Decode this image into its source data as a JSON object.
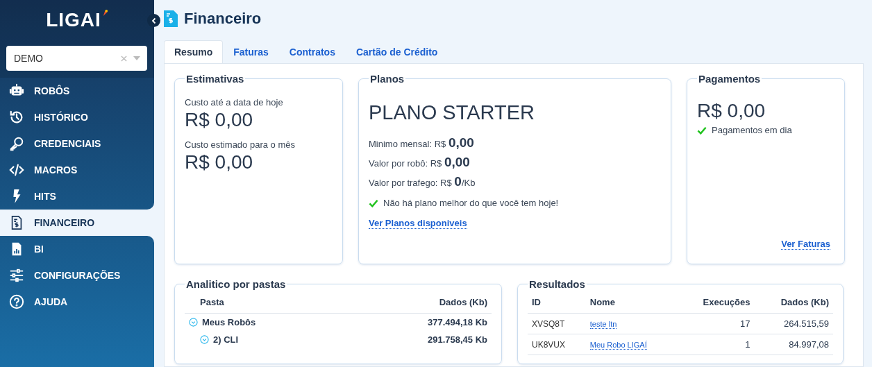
{
  "sidebar": {
    "logo": "LIGAI",
    "company_select": {
      "value": "DEMO"
    },
    "menu": [
      {
        "label": "ROBÔS",
        "kind": "robot",
        "selected": false
      },
      {
        "label": "HISTÓRICO",
        "kind": "history",
        "selected": false
      },
      {
        "label": "CREDENCIAIS",
        "kind": "key",
        "selected": false
      },
      {
        "label": "MACROS",
        "kind": "code",
        "selected": false
      },
      {
        "label": "HITS",
        "kind": "bolt",
        "selected": false
      },
      {
        "label": "FINANCEIRO",
        "kind": "invoice",
        "selected": true
      },
      {
        "label": "BI",
        "kind": "report",
        "selected": false
      },
      {
        "label": "CONFIGURAÇÕES",
        "kind": "sliders",
        "selected": false
      },
      {
        "label": "AJUDA",
        "kind": "help",
        "selected": false
      }
    ]
  },
  "header": {
    "title": "Financeiro"
  },
  "tabs": [
    {
      "label": "Resumo",
      "selected": true
    },
    {
      "label": "Faturas",
      "selected": false
    },
    {
      "label": "Contratos",
      "selected": false
    },
    {
      "label": "Cartão de Crédito",
      "selected": false
    }
  ],
  "estimates": {
    "legend": "Estimativas",
    "items": [
      {
        "label": "Custo até a data de hoje",
        "value": "R$ 0,00"
      },
      {
        "label": "Custo estimado para o mês",
        "value": "R$ 0,00"
      }
    ]
  },
  "plans": {
    "legend": "Planos",
    "plan_name": "PLANO STARTER",
    "lines": [
      {
        "label": "Minimo mensal: R$",
        "value": "0,00"
      },
      {
        "label": "Valor por robô: R$",
        "value": "0,00"
      },
      {
        "label": "Valor por trafego: R$",
        "value": "0",
        "suffix": "/Kb"
      }
    ],
    "message": "Não há plano melhor do que você tem hoje!",
    "link": "Ver Planos disponiveis"
  },
  "payments": {
    "legend": "Pagamentos",
    "amount": "R$ 0,00",
    "status": "Pagamentos em dia",
    "link": "Ver Faturas"
  },
  "folders": {
    "legend": "Analitico por pastas",
    "columns": [
      "Pasta",
      "Dados (Kb)"
    ],
    "rows": [
      {
        "name": "Meus Robôs",
        "data": "377.494,18 Kb",
        "expanded": true,
        "children": [
          {
            "name": "2) CLI",
            "data": "291.758,45 Kb",
            "expanded": true
          }
        ]
      }
    ]
  },
  "results": {
    "legend": "Resultados",
    "columns": [
      "ID",
      "Nome",
      "Execuções",
      "Dados (Kb)"
    ],
    "rows": [
      {
        "id": "XVSQ8T",
        "name": "teste ltn",
        "executions": "17",
        "data": "264.515,59"
      },
      {
        "id": "UK8VUX",
        "name": "Meu Robo LIGAÍ",
        "executions": "1",
        "data": "84.997,08"
      }
    ]
  }
}
